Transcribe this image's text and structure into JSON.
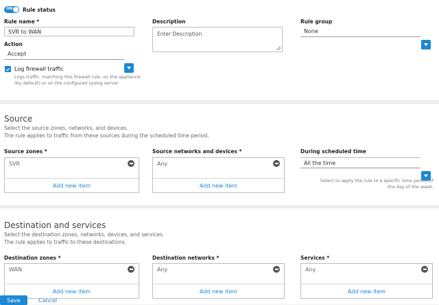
{
  "rule": {
    "toggle_label": "ON",
    "status_label": "Rule status",
    "name_label": "Rule name *",
    "name_value": "SVR to WAN",
    "action_label": "Action",
    "action_value": "Accept",
    "log_label": "Log firewall traffic",
    "log_help": "Logs traffic, matching this firewall rule, on the appliance (by default) or on the configured syslog server.",
    "description_label": "Description",
    "description_placeholder": "Enter Description",
    "group_label": "Rule group",
    "group_value": "None"
  },
  "source": {
    "title": "Source",
    "desc1": "Select the source zones, networks, and devices.",
    "desc2": "The rule applies to traffic from these sources during the scheduled time period.",
    "zones_label": "Source zones *",
    "zones_item": "SVR",
    "networks_label": "Source networks and devices *",
    "networks_item": "Any",
    "add_label": "Add new item",
    "schedule_label": "During scheduled time",
    "schedule_value": "All the time",
    "schedule_help": "Select to apply the rule to a specific time period of the day of the week."
  },
  "destination": {
    "title": "Destination and services",
    "desc1": "Select the destination zones, networks, devices, and services.",
    "desc2": "The rule applies to traffic to these destinations.",
    "zones_label": "Destination zones *",
    "zones_item": "WAN",
    "networks_label": "Destination networks *",
    "networks_item": "Any",
    "services_label": "Services *",
    "services_item": "Any",
    "add_label": "Add new item"
  },
  "footer": {
    "save_label": "Save",
    "cancel_label": "Cancel"
  },
  "colors": {
    "accent": "#1e88d4",
    "background": "#f3f3f3",
    "panel": "#ffffff"
  }
}
